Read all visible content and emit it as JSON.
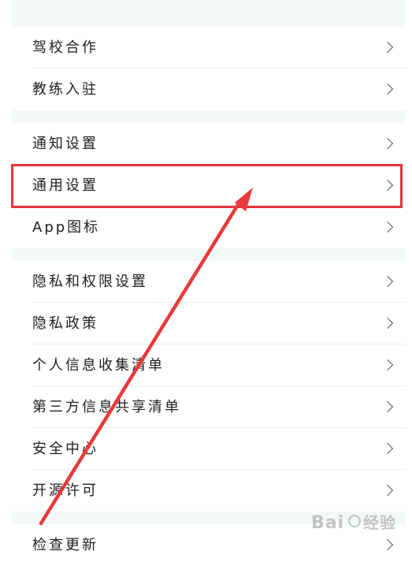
{
  "menu": {
    "group1": [
      {
        "label": "驾校合作"
      },
      {
        "label": "教练入驻"
      }
    ],
    "group2": [
      {
        "label": "通知设置"
      },
      {
        "label": "通用设置"
      },
      {
        "label": "App图标"
      }
    ],
    "group3": [
      {
        "label": "隐私和权限设置"
      },
      {
        "label": "隐私政策"
      },
      {
        "label": "个人信息收集清单"
      },
      {
        "label": "第三方信息共享清单"
      },
      {
        "label": "安全中心"
      },
      {
        "label": "开源许可"
      }
    ],
    "group4": [
      {
        "label": "检查更新"
      }
    ]
  },
  "colors": {
    "highlight": "#e2353b",
    "arrow": "#e73a3a",
    "section_gap": "#f3f8f8"
  },
  "icons": {
    "chevron": "chevron-right-icon"
  }
}
